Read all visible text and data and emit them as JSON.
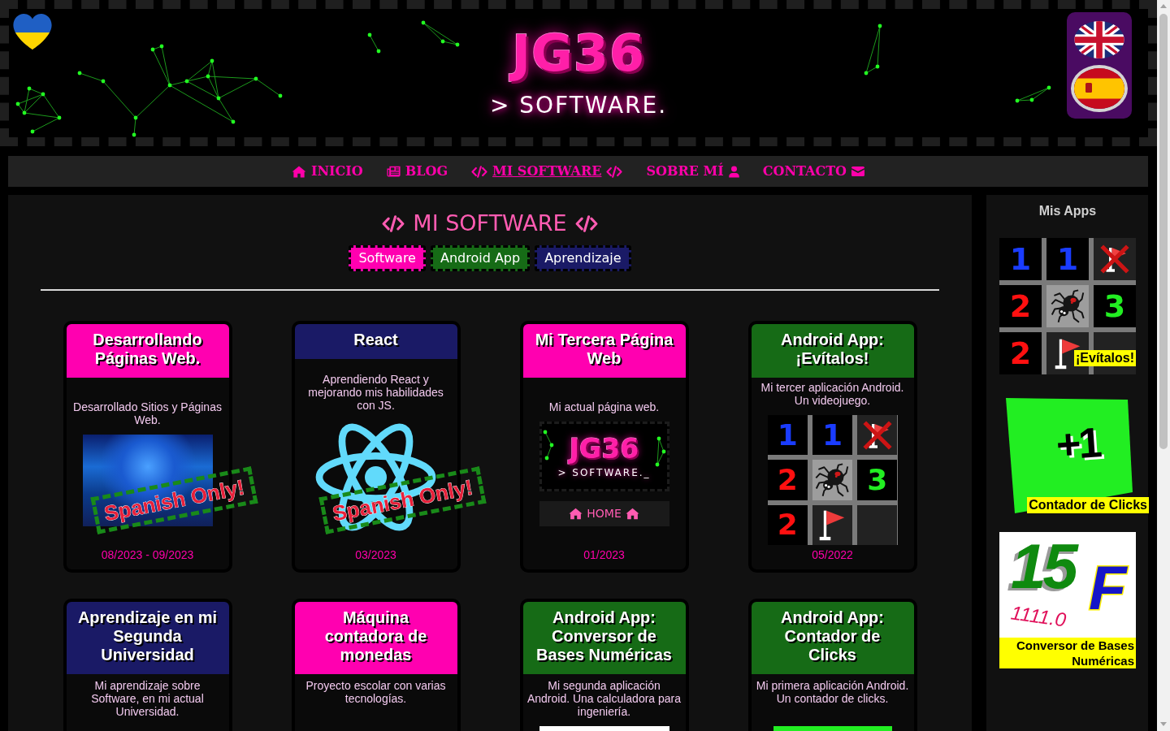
{
  "header": {
    "logo": "JG36",
    "tagline": "> SOFTWARE.",
    "languages": [
      {
        "kind": "english",
        "selected": false
      },
      {
        "kind": "spanish",
        "selected": true
      }
    ]
  },
  "nav": [
    {
      "label": "INICIO",
      "kind": "home",
      "selected": false
    },
    {
      "label": "BLOG",
      "kind": "blog",
      "selected": false
    },
    {
      "label": "MI SOFTWARE",
      "kind": "code",
      "selected": true
    },
    {
      "label": "SOBRE MÍ",
      "kind": "about",
      "selected": false
    },
    {
      "label": "CONTACTO",
      "kind": "contact",
      "selected": false
    }
  ],
  "main": {
    "title": "MI SOFTWARE",
    "categories": [
      {
        "label": "Software",
        "color": "#ff00b0"
      },
      {
        "label": "Android App",
        "color": "#166b16"
      },
      {
        "label": "Aprendizaje",
        "color": "#1a1a66"
      }
    ],
    "cards": [
      {
        "title": "Desarrollando Páginas Web.",
        "color": "#ff00b0",
        "description": "Desarrollado Sitios y Páginas Web.",
        "image": {
          "kind": "photo"
        },
        "stamp": "Spanish Only!",
        "date": "08/2023 - 09/2023"
      },
      {
        "title": "React",
        "color": "#1a1a66",
        "description": "Aprendiendo React y mejorando mis habilidades con JS.",
        "image": {
          "kind": "atom"
        },
        "stamp": "Spanish Only!",
        "date": "03/2023"
      },
      {
        "title": "Mi Tercera Página Web",
        "color": "#ff00b0",
        "description": "Mi actual página web.",
        "image": {
          "kind": "screenshot",
          "logo": "JG36",
          "tagline": "> SOFTWARE._",
          "link": "HOME"
        },
        "date": "01/2023"
      },
      {
        "title": "Android App: ¡Evítalos!",
        "color": "#166b16",
        "description": "Mi tercer aplicación Android. Un videojuego.",
        "image": {
          "kind": "minesweeper",
          "cells": [
            {
              "kind": "number",
              "label": "1",
              "color": "#1a3cff"
            },
            {
              "kind": "number",
              "label": "1",
              "color": "#1a3cff"
            },
            {
              "kind": "crossed"
            },
            {
              "kind": "number",
              "label": "2",
              "color": "#ff1010"
            },
            {
              "kind": "spider"
            },
            {
              "kind": "number",
              "label": "3",
              "color": "#22ee22"
            },
            {
              "kind": "number",
              "label": "2",
              "color": "#ff1010"
            },
            {
              "kind": "flag"
            },
            {
              "kind": "hidden"
            }
          ]
        },
        "date": "05/2022"
      },
      {
        "title": "Aprendizaje en mi Segunda Universidad",
        "color": "#1a1a66",
        "description": "Mi aprendizaje sobre Software, en mi actual Universidad."
      },
      {
        "title": "Máquina contadora de monedas",
        "color": "#ff00b0",
        "description": "Proyecto escolar con varias tecnologías."
      },
      {
        "title": "Android App: Conversor de Bases Numéricas",
        "color": "#166b16",
        "description": "Mi segunda aplicación Android. Una calculadora para ingeniería.",
        "image": {
          "kind": "paper"
        }
      },
      {
        "title": "Android App: Contador de Clicks",
        "color": "#166b16",
        "description": "Mi primera aplicación Android. Un contador de clicks.",
        "image": {
          "kind": "tile"
        }
      }
    ]
  },
  "sidebar": {
    "title": "Mis Apps",
    "apps": [
      {
        "kind": "minesweeper",
        "label": "¡Evítalos!",
        "cells": [
          {
            "kind": "number",
            "label": "1",
            "color": "#1a3cff"
          },
          {
            "kind": "number",
            "label": "1",
            "color": "#1a3cff"
          },
          {
            "kind": "crossed"
          },
          {
            "kind": "number",
            "label": "2",
            "color": "#ff1010"
          },
          {
            "kind": "spider"
          },
          {
            "kind": "number",
            "label": "3",
            "color": "#22ee22"
          },
          {
            "kind": "number",
            "label": "2",
            "color": "#ff1010"
          },
          {
            "kind": "flag"
          },
          {
            "kind": "hidden"
          }
        ]
      },
      {
        "kind": "counter",
        "label": "Contador de Clicks",
        "symbol": "+1"
      },
      {
        "kind": "converter",
        "label": "Conversor de Bases Numéricas",
        "number": "15",
        "binary": "1111.0",
        "letter": "F"
      }
    ]
  }
}
